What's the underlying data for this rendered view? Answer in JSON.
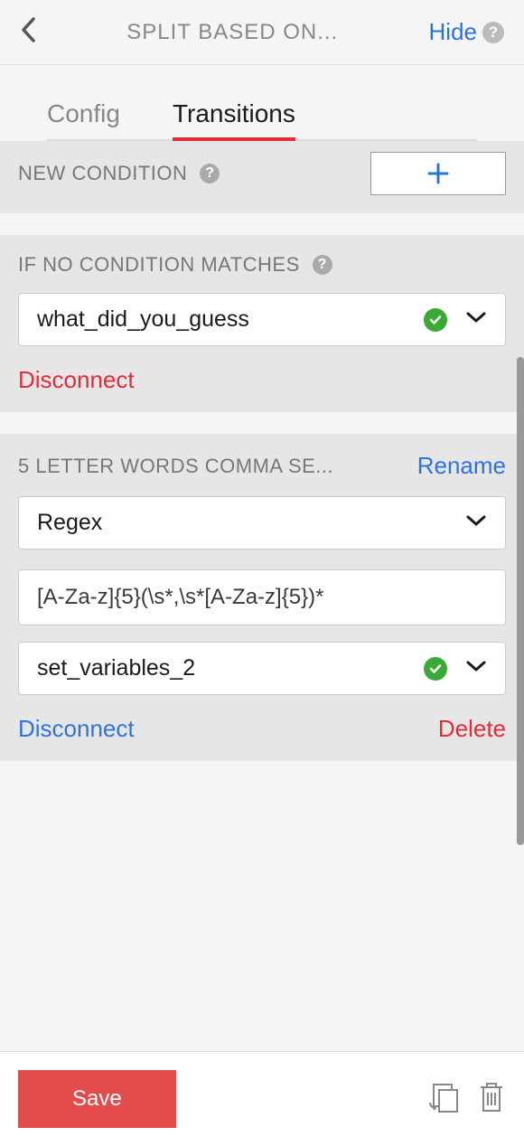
{
  "header": {
    "title": "SPLIT BASED ON...",
    "hide_label": "Hide"
  },
  "tabs": {
    "config": "Config",
    "transitions": "Transitions"
  },
  "new_condition": {
    "label": "NEW CONDITION"
  },
  "no_match": {
    "label": "IF NO CONDITION MATCHES",
    "selected": "what_did_you_guess",
    "disconnect": "Disconnect"
  },
  "condition1": {
    "title": "5 LETTER WORDS COMMA SE...",
    "rename": "Rename",
    "type_selected": "Regex",
    "pattern": "[A-Za-z]{5}(\\s*,\\s*[A-Za-z]{5})*",
    "target": "set_variables_2",
    "disconnect": "Disconnect",
    "delete": "Delete"
  },
  "footer": {
    "save": "Save"
  }
}
